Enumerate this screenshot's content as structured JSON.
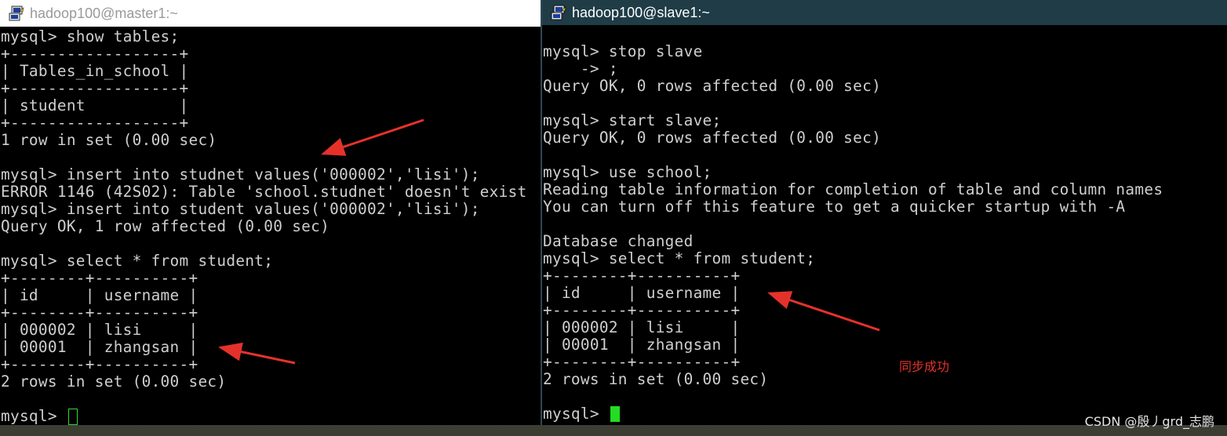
{
  "colors": {
    "terminal_bg": "#000000",
    "terminal_text": "#cfcfcf",
    "cursor": "#22dd22",
    "annotation": "#e4322b",
    "left_titlebar": "#ffffff",
    "right_titlebar": "#1f3c47"
  },
  "left_window": {
    "title": "hadoop100@master1:~",
    "icon": "putty-icon",
    "lines": [
      "mysql> show tables;",
      "+------------------+",
      "| Tables_in_school |",
      "+------------------+",
      "| student          |",
      "+------------------+",
      "1 row in set (0.00 sec)",
      "",
      "mysql> insert into studnet values('000002','lisi');",
      "ERROR 1146 (42S02): Table 'school.studnet' doesn't exist",
      "mysql> insert into student values('000002','lisi');",
      "Query OK, 1 row affected (0.00 sec)",
      "",
      "mysql> select * from student;",
      "+--------+----------+",
      "| id     | username |",
      "+--------+----------+",
      "| 000002 | lisi     |",
      "| 00001  | zhangsan |",
      "+--------+----------+",
      "2 rows in set (0.00 sec)",
      ""
    ],
    "prompt": "mysql> "
  },
  "right_window": {
    "title": "hadoop100@slave1:~",
    "icon": "putty-icon",
    "lines": [
      "mysql> stop slave",
      "    -> ;",
      "Query OK, 0 rows affected (0.00 sec)",
      "",
      "mysql> start slave;",
      "Query OK, 0 rows affected (0.00 sec)",
      "",
      "mysql> use school;",
      "Reading table information for completion of table and column names",
      "You can turn off this feature to get a quicker startup with -A",
      "",
      "Database changed",
      "mysql> select * from student;",
      "+--------+----------+",
      "| id     | username |",
      "+--------+----------+",
      "| 000002 | lisi     |",
      "| 00001  | zhangsan |",
      "+--------+----------+",
      "2 rows in set (0.00 sec)",
      ""
    ],
    "prompt": "mysql> "
  },
  "annotation": {
    "text": "同步成功"
  },
  "watermark": {
    "text": "CSDN @殷丿grd_志鹏"
  }
}
